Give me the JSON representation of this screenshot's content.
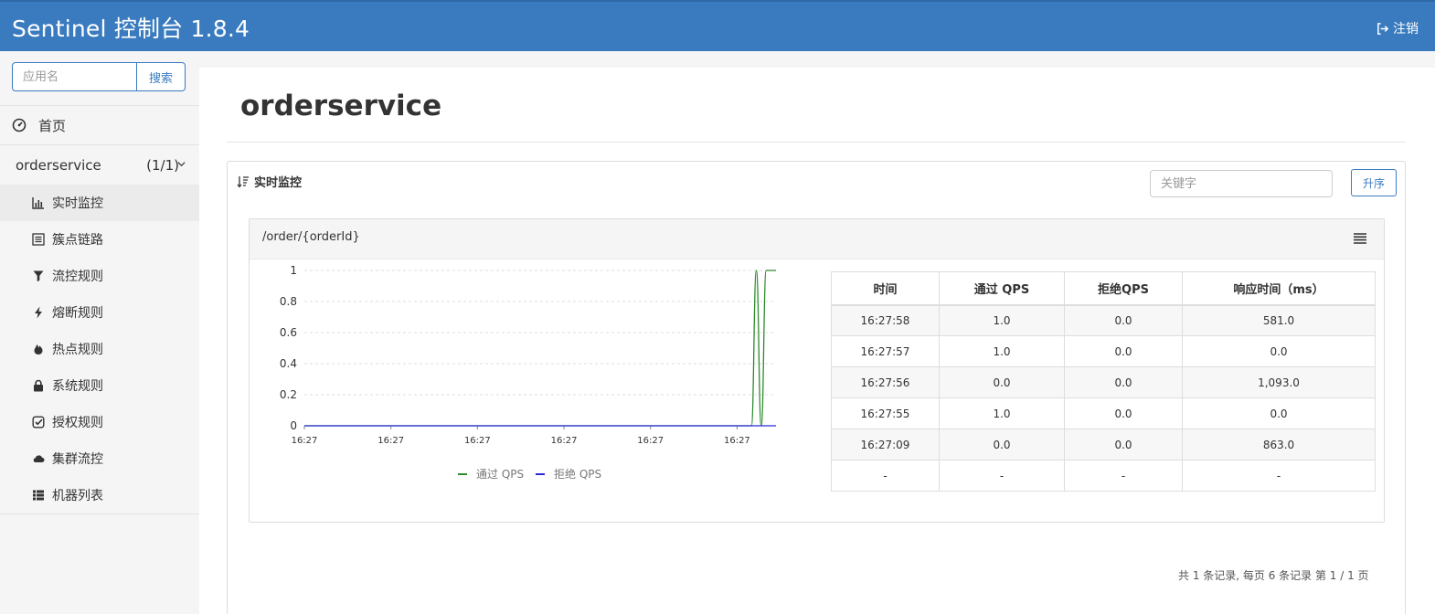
{
  "header": {
    "brand": "Sentinel 控制台 1.8.4",
    "logout_label": "注销"
  },
  "sidebar": {
    "search_placeholder": "应用名",
    "search_button": "搜索",
    "home_label": "首页",
    "app": {
      "name": "orderservice",
      "count": "(1/1)"
    },
    "menu": [
      {
        "label": "实时监控",
        "icon": "bar-chart-icon",
        "active": true
      },
      {
        "label": "簇点链路",
        "icon": "list-alt-icon",
        "active": false
      },
      {
        "label": "流控规则",
        "icon": "filter-icon",
        "active": false
      },
      {
        "label": "熔断规则",
        "icon": "flash-icon",
        "active": false
      },
      {
        "label": "热点规则",
        "icon": "fire-icon",
        "active": false
      },
      {
        "label": "系统规则",
        "icon": "lock-icon",
        "active": false
      },
      {
        "label": "授权规则",
        "icon": "check-icon",
        "active": false
      },
      {
        "label": "集群流控",
        "icon": "cloud-icon",
        "active": false
      },
      {
        "label": "机器列表",
        "icon": "th-list-icon",
        "active": false
      }
    ]
  },
  "main": {
    "title": "orderservice",
    "panel_title": "实时监控",
    "keyword_placeholder": "关键字",
    "sort_button": "升序",
    "card": {
      "resource": "/order/{orderId}",
      "table": {
        "headers": [
          "时间",
          "通过 QPS",
          "拒绝QPS",
          "响应时间（ms）"
        ],
        "rows": [
          [
            "16:27:58",
            "1.0",
            "0.0",
            "581.0"
          ],
          [
            "16:27:57",
            "1.0",
            "0.0",
            "0.0"
          ],
          [
            "16:27:56",
            "0.0",
            "0.0",
            "1,093.0"
          ],
          [
            "16:27:55",
            "1.0",
            "0.0",
            "0.0"
          ],
          [
            "16:27:09",
            "0.0",
            "0.0",
            "863.0"
          ],
          [
            "-",
            "-",
            "-",
            "-"
          ]
        ]
      }
    },
    "pager": "共 1 条记录, 每页 6 条记录 第 1 / 1 页"
  },
  "chart_data": {
    "type": "line",
    "x_tick_labels": [
      "16:27",
      "16:27",
      "16:27",
      "16:27",
      "16:27",
      "16:27"
    ],
    "y_ticks": [
      "0",
      "0.2",
      "0.4",
      "0.6",
      "0.8",
      "1"
    ],
    "ylim": [
      0,
      1
    ],
    "grid": "horizontal dashed",
    "legend_position": "bottom",
    "series": [
      {
        "name": "通过 QPS",
        "color": "#2e8b2e",
        "values": [
          0,
          0,
          0,
          0,
          0,
          0,
          0,
          0,
          0,
          0,
          0,
          0,
          0,
          0,
          0,
          0,
          0,
          0,
          0,
          0,
          0,
          0,
          0,
          0,
          0,
          0,
          0,
          0,
          0,
          0,
          0,
          0,
          0,
          0,
          0,
          0,
          0,
          0,
          0,
          0,
          0,
          0,
          0,
          0,
          0,
          0,
          0,
          0,
          0,
          0,
          0,
          0,
          0,
          0,
          0,
          0,
          0,
          0,
          0,
          0,
          0,
          0,
          0,
          0,
          0,
          0,
          0,
          0,
          0,
          0,
          0,
          0,
          0,
          0,
          0,
          0,
          0,
          0,
          0,
          0,
          0,
          0,
          0,
          0,
          0,
          0,
          0,
          0,
          0,
          0,
          0,
          0,
          1,
          0,
          1,
          1,
          1
        ]
      },
      {
        "name": "拒绝 QPS",
        "color": "#2b2bd6",
        "values": [
          0,
          0,
          0,
          0,
          0,
          0,
          0,
          0,
          0,
          0,
          0,
          0,
          0,
          0,
          0,
          0,
          0,
          0,
          0,
          0,
          0,
          0,
          0,
          0,
          0,
          0,
          0,
          0,
          0,
          0,
          0,
          0,
          0,
          0,
          0,
          0,
          0,
          0,
          0,
          0,
          0,
          0,
          0,
          0,
          0,
          0,
          0,
          0,
          0,
          0,
          0,
          0,
          0,
          0,
          0,
          0,
          0,
          0,
          0,
          0,
          0,
          0,
          0,
          0,
          0,
          0,
          0,
          0,
          0,
          0,
          0,
          0,
          0,
          0,
          0,
          0,
          0,
          0,
          0,
          0,
          0,
          0,
          0,
          0,
          0,
          0,
          0,
          0,
          0,
          0,
          0,
          0,
          0,
          0,
          0,
          0,
          0
        ]
      }
    ]
  }
}
